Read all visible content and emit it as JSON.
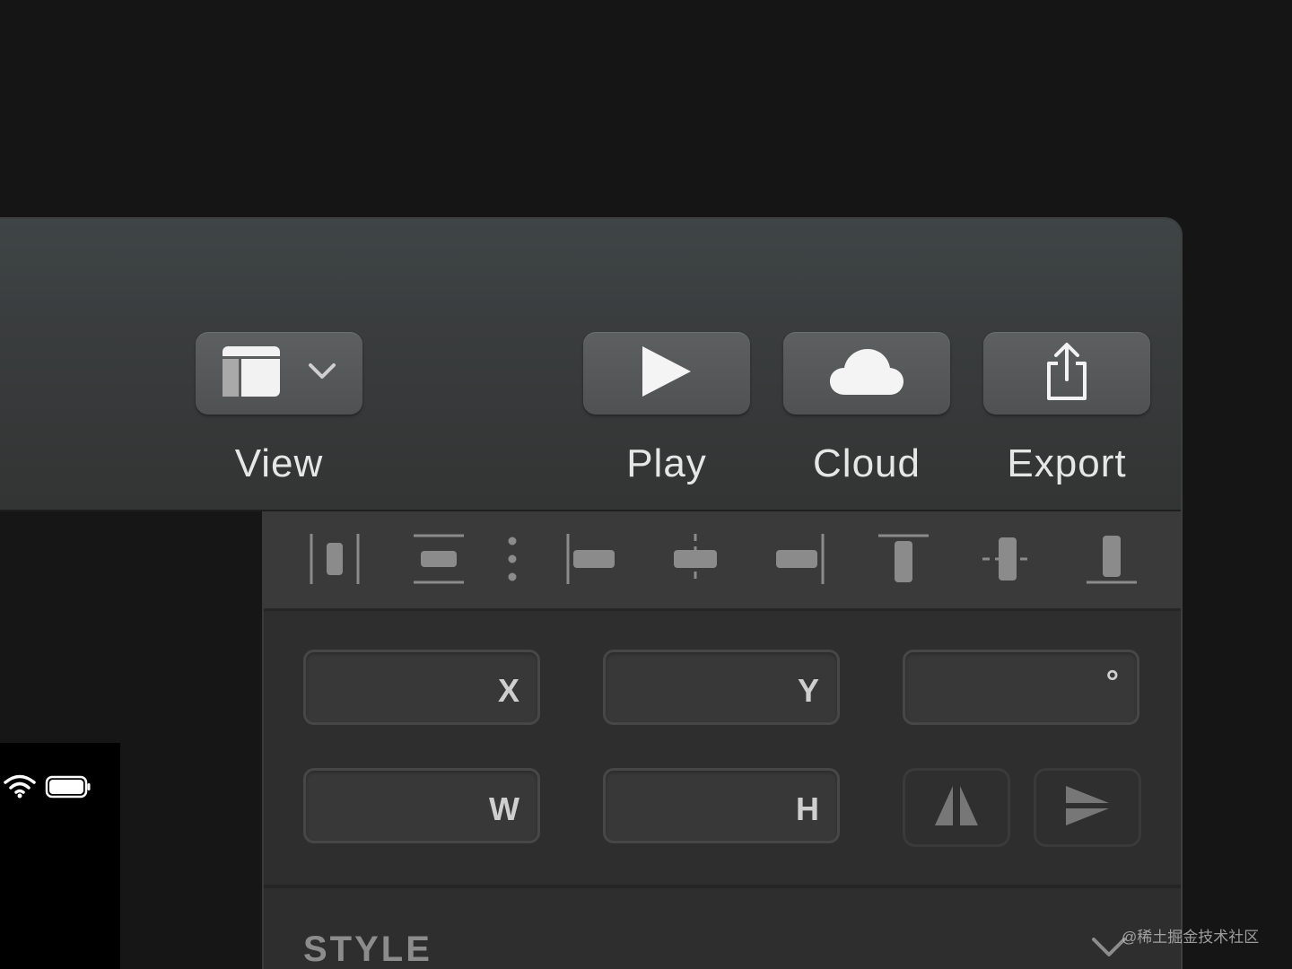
{
  "toolbar": {
    "view_label": "View",
    "play_label": "Play",
    "cloud_label": "Cloud",
    "export_label": "Export"
  },
  "inspector": {
    "align_tools": [
      "distribute-horizontal-icon",
      "distribute-vertical-icon",
      "more-options-icon",
      "align-left-icon",
      "align-center-horizontal-icon",
      "align-right-icon",
      "align-top-icon",
      "align-center-vertical-icon",
      "align-bottom-icon"
    ],
    "fields": {
      "x_label": "X",
      "y_label": "Y",
      "rotation_label": "°",
      "w_label": "W",
      "h_label": "H"
    },
    "style_section_title": "STYLE"
  },
  "watermark": "@稀土掘金技术社区",
  "colors": {
    "background": "#151515",
    "toolbar_button": "#575959",
    "label_text": "#e6e6e6",
    "field_background": "#383838"
  }
}
